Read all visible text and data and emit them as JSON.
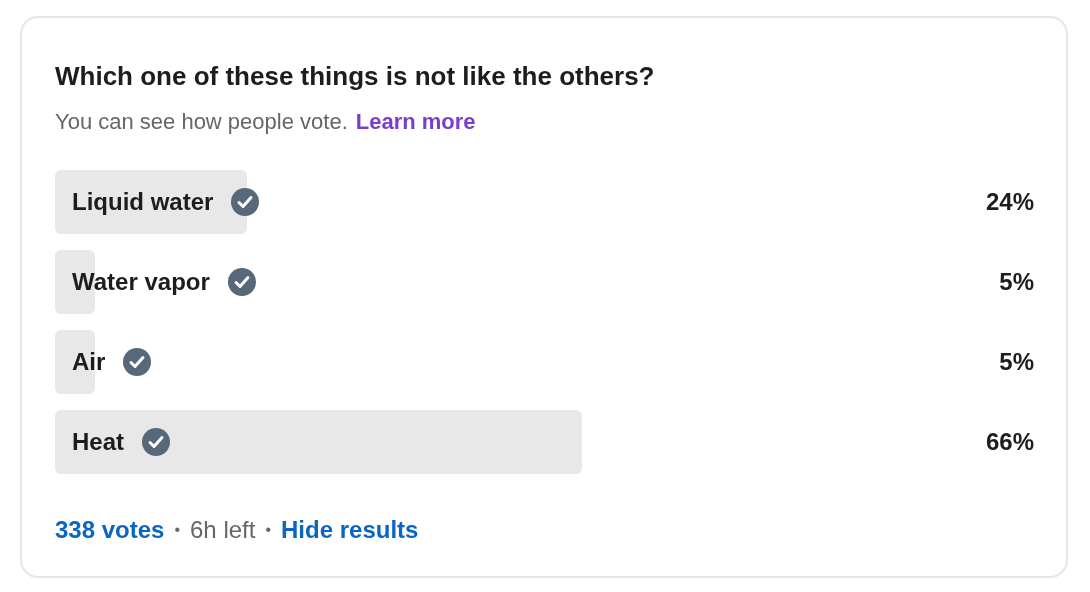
{
  "poll": {
    "question": "Which one of these things is not like the others?",
    "note": "You can see how people vote.",
    "learn_more": "Learn more",
    "options": [
      {
        "label": "Liquid water",
        "checked": true,
        "percent": "24%"
      },
      {
        "label": "Water vapor",
        "checked": true,
        "percent": "5%"
      },
      {
        "label": "Air",
        "checked": true,
        "percent": "5%"
      },
      {
        "label": "Heat",
        "checked": true,
        "percent": "66%"
      }
    ],
    "votes": "338 votes",
    "separator_1": "•",
    "time_left": "6h left",
    "separator_2": "•",
    "hide_results": "Hide results"
  }
}
